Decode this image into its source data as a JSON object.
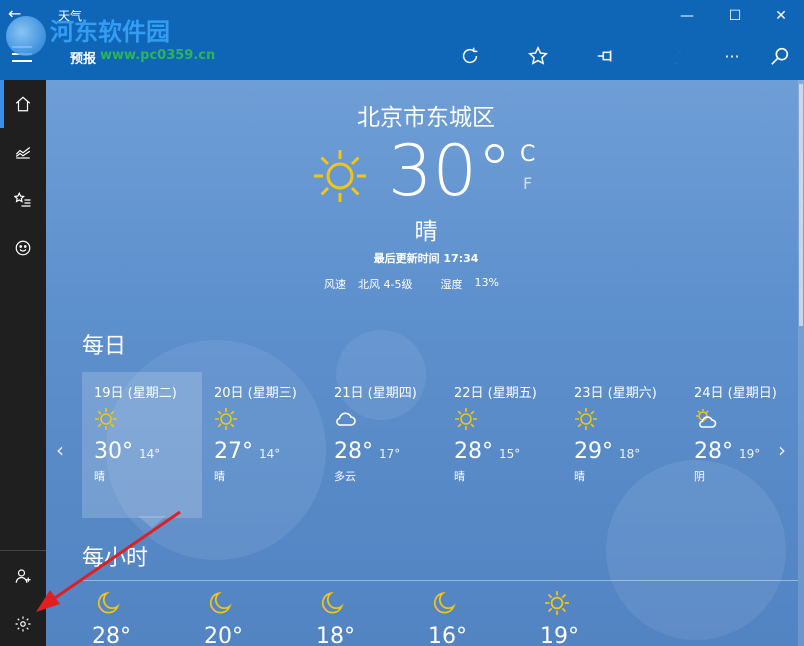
{
  "window": {
    "title": "天气",
    "back_glyph": "←",
    "min_glyph": "—",
    "max_glyph": "☐",
    "close_glyph": "✕"
  },
  "appbar": {
    "section": "预报",
    "actions": [
      "refresh-icon",
      "favorite-star-icon",
      "pin-icon",
      "moon-icon",
      "more-icon",
      "search-icon"
    ],
    "more_glyph": "···"
  },
  "watermark": {
    "title": "河东软件园",
    "url": "www.pc0359.cn"
  },
  "sidebar": {
    "top_items": [
      "home-icon",
      "historical-chart-icon",
      "favorites-list-icon",
      "feedback-smile-icon"
    ],
    "bottom_items": [
      "account-add-icon",
      "settings-gear-icon"
    ]
  },
  "current": {
    "location": "北京市东城区",
    "temperature": "30°",
    "unit_c": "C",
    "unit_f": "F",
    "condition": "晴",
    "updated": "最后更新时间 17:34",
    "wind_label": "风速",
    "wind_value": "北风 4-5级",
    "humidity_label": "湿度",
    "humidity_value": "13%"
  },
  "daily": {
    "title": "每日",
    "prev_glyph": "‹",
    "next_glyph": "›",
    "days": [
      {
        "name": "19日 (星期二)",
        "icon": "sun-icon",
        "hi": "30°",
        "lo": "14°",
        "cond": "晴"
      },
      {
        "name": "20日 (星期三)",
        "icon": "sun-icon",
        "hi": "27°",
        "lo": "14°",
        "cond": "晴"
      },
      {
        "name": "21日 (星期四)",
        "icon": "cloud-icon",
        "hi": "28°",
        "lo": "17°",
        "cond": "多云"
      },
      {
        "name": "22日 (星期五)",
        "icon": "sun-icon",
        "hi": "28°",
        "lo": "15°",
        "cond": "晴"
      },
      {
        "name": "23日 (星期六)",
        "icon": "sun-icon",
        "hi": "29°",
        "lo": "18°",
        "cond": "晴"
      },
      {
        "name": "24日 (星期日)",
        "icon": "partly-cloudy-icon",
        "hi": "28°",
        "lo": "19°",
        "cond": "阴"
      }
    ]
  },
  "hourly": {
    "title": "每小时",
    "hours": [
      {
        "icon": "moon-icon",
        "temp": "28°"
      },
      {
        "icon": "moon-icon",
        "temp": "20°"
      },
      {
        "icon": "moon-icon",
        "temp": "18°"
      },
      {
        "icon": "moon-icon",
        "temp": "16°"
      },
      {
        "icon": "sun-icon",
        "temp": "19°"
      }
    ]
  },
  "colors": {
    "titlebar": "#0f66b7",
    "sidebar": "#1f1f1f",
    "sun": "#f3c515",
    "annotation_arrow": "#e02020"
  }
}
